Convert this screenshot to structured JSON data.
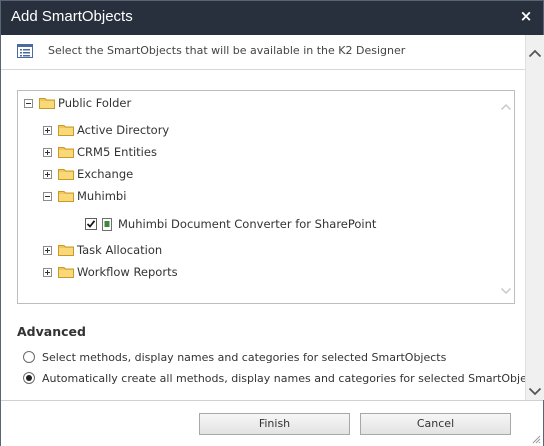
{
  "dialog": {
    "title": "Add SmartObjects",
    "close_glyph": "×",
    "instruction": "Select the SmartObjects that will be available in the K2 Designer"
  },
  "tree": {
    "root": {
      "label": "Public Folder",
      "expanded": true
    },
    "items": [
      {
        "label": "Active Directory",
        "expanded": false
      },
      {
        "label": "CRM5 Entities",
        "expanded": false
      },
      {
        "label": "Exchange",
        "expanded": false
      },
      {
        "label": "Muhimbi",
        "expanded": true
      },
      {
        "label": "Task Allocation",
        "expanded": false
      },
      {
        "label": "Workflow Reports",
        "expanded": false
      }
    ],
    "child": {
      "label": "Muhimbi Document Converter for SharePoint",
      "checked": true
    }
  },
  "advanced": {
    "heading": "Advanced",
    "options": [
      {
        "label": "Select methods, display names and categories for selected SmartObjects",
        "selected": false
      },
      {
        "label": "Automatically create all methods, display names and categories for selected SmartObjects",
        "selected": true
      }
    ]
  },
  "buttons": {
    "finish": "Finish",
    "cancel": "Cancel"
  },
  "colors": {
    "titlebar": "#28303d",
    "folder": "#f2c75a",
    "doc_accent": "#3a8a3a"
  },
  "icons": {
    "close": "close-icon",
    "list": "list-icon",
    "folder": "folder-icon",
    "smartobject": "smartobject-icon"
  }
}
